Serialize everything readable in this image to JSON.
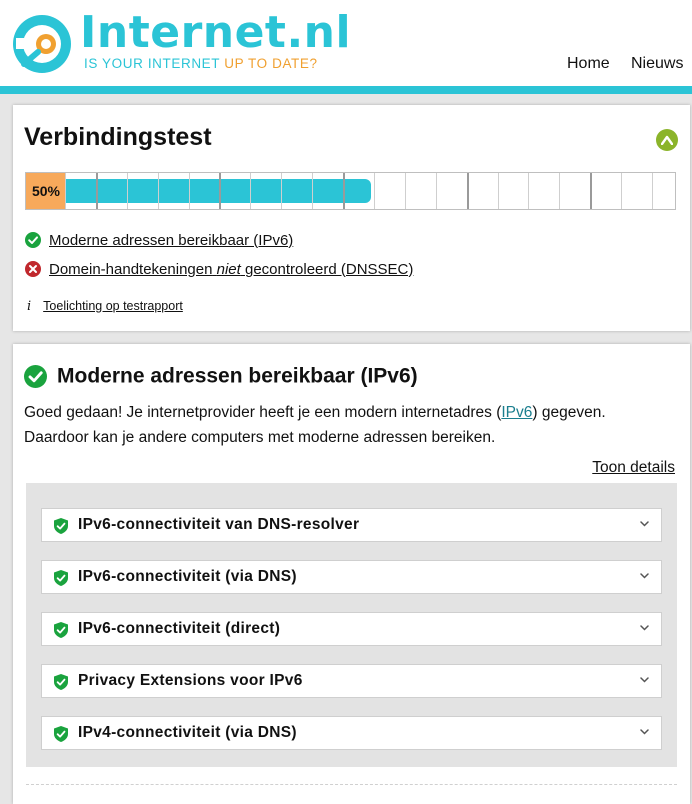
{
  "header": {
    "brand": "Internet.nl",
    "tagline_part1": "IS YOUR INTERNET",
    "tagline_part2": "UP TO DATE?",
    "nav": {
      "home": "Home",
      "news": "Nieuws"
    },
    "colors": {
      "brand": "#2bc4d6",
      "accent": "#f0a030"
    }
  },
  "summary": {
    "title": "Verbindingstest",
    "progress": {
      "label": "50%",
      "value": 0.5
    },
    "results": [
      {
        "status": "pass",
        "text": "Moderne adressen bereikbaar (IPv6)"
      },
      {
        "status": "fail",
        "text_before": "Domein-handtekeningen",
        "text_emph": "niet",
        "text_after": "gecontroleerd (DNSSEC)"
      }
    ],
    "info": {
      "icon": "info-icon",
      "link": "Toelichting op testrapport"
    }
  },
  "ipv6": {
    "title": "Moderne adressen bereikbaar (IPv6)",
    "desc_before": "Goed gedaan! Je internetprovider heeft je een modern internetadres (",
    "desc_link": "IPv6",
    "desc_after": ") gegeven. Daardoor kan je andere computers met moderne adressen bereiken.",
    "toggle": "Toon details",
    "tests": [
      {
        "label": "IPv6-connectiviteit van DNS-resolver",
        "status": "pass"
      },
      {
        "label": "IPv6-connectiviteit (via DNS)",
        "status": "pass"
      },
      {
        "label": "IPv6-connectiviteit (direct)",
        "status": "pass"
      },
      {
        "label": "Privacy Extensions voor IPv6",
        "status": "pass"
      },
      {
        "label": "IPv4-connectiviteit (via DNS)",
        "status": "pass"
      }
    ]
  },
  "colors": {
    "pass": "#1aa33e",
    "fail": "#c0282d",
    "progress_pct_bg": "#f7a95b",
    "progress_fill": "#2bc4d6",
    "collapse": "#8bb42a"
  }
}
